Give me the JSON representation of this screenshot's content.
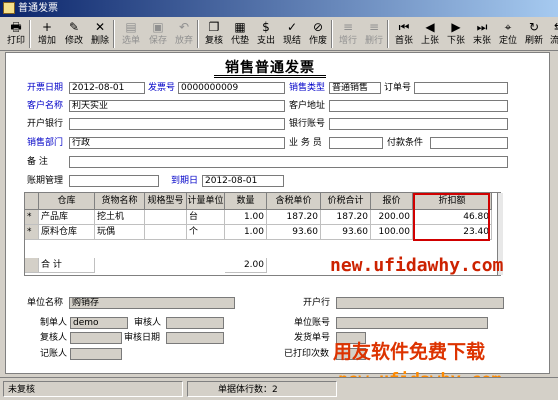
{
  "window": {
    "title": "普通发票"
  },
  "toolbar": [
    {
      "icon": "🖶",
      "label": "打印",
      "name": "print",
      "enabled": true
    },
    {
      "icon": "+",
      "label": "增加",
      "name": "add",
      "enabled": true
    },
    {
      "icon": "✎",
      "label": "修改",
      "name": "modify",
      "enabled": true
    },
    {
      "icon": "✕",
      "label": "删除",
      "name": "delete",
      "enabled": true
    },
    {
      "icon": "▤",
      "label": "选单",
      "name": "select-order",
      "enabled": false
    },
    {
      "icon": "▣",
      "label": "保存",
      "name": "save",
      "enabled": false
    },
    {
      "icon": "↶",
      "label": "放弃",
      "name": "abandon",
      "enabled": false
    },
    {
      "icon": "❐",
      "label": "复核",
      "name": "review",
      "enabled": true
    },
    {
      "icon": "▦",
      "label": "代垫",
      "name": "advance",
      "enabled": true
    },
    {
      "icon": "$",
      "label": "支出",
      "name": "expense",
      "enabled": true
    },
    {
      "icon": "✓",
      "label": "现结",
      "name": "cash-settle",
      "enabled": true
    },
    {
      "icon": "⊘",
      "label": "作废",
      "name": "void",
      "enabled": true
    },
    {
      "icon": "≡",
      "label": "增行",
      "name": "add-row",
      "enabled": false
    },
    {
      "icon": "≡",
      "label": "删行",
      "name": "delete-row",
      "enabled": false
    },
    {
      "icon": "⏮",
      "label": "首张",
      "name": "first",
      "enabled": true
    },
    {
      "icon": "◀",
      "label": "上张",
      "name": "prev",
      "enabled": true
    },
    {
      "icon": "▶",
      "label": "下张",
      "name": "next",
      "enabled": true
    },
    {
      "icon": "⏭",
      "label": "末张",
      "name": "last",
      "enabled": true
    },
    {
      "icon": "⌖",
      "label": "定位",
      "name": "locate",
      "enabled": true
    },
    {
      "icon": "↻",
      "label": "刷新",
      "name": "refresh",
      "enabled": true
    },
    {
      "icon": "⇆",
      "label": "流转",
      "name": "flow",
      "enabled": true
    }
  ],
  "form": {
    "title": "销售普通发票",
    "fields": {
      "invoice_date_label": "开票日期",
      "invoice_date": "2012-08-01",
      "invoice_no_label": "发票号",
      "invoice_no": "0000000009",
      "sales_type_label": "销售类型",
      "sales_type": "普通销售",
      "order_no_label": "订单号",
      "order_no": "",
      "customer_label": "客户名称",
      "customer": "利天实业",
      "customer_addr_label": "客户地址",
      "customer_addr": "",
      "bank_label": "开户银行",
      "bank": "",
      "account_label": "银行账号",
      "account": "",
      "dept_label": "销售部门",
      "dept": "行政",
      "salesman_label": "业 务 员",
      "salesman": "",
      "terms_label": "付款条件",
      "terms": "",
      "remark_label": "备    注",
      "remark": "",
      "period_label": "账期管理",
      "period": "",
      "due_label": "到期日",
      "due": "2012-08-01"
    }
  },
  "grid": {
    "headers": [
      "仓库",
      "货物名称",
      "规格型号",
      "计量单位",
      "数量",
      "含税单价",
      "价税合计",
      "报价",
      "折扣额"
    ],
    "rows": [
      {
        "mark": "*",
        "warehouse": "产品库",
        "goods": "挖土机",
        "spec": "",
        "unit": "台",
        "qty": "1.00",
        "price": "187.20",
        "total": "187.20",
        "quote": "200.00",
        "discount": "46.80"
      },
      {
        "mark": "*",
        "warehouse": "原料仓库",
        "goods": "玩偶",
        "spec": "",
        "unit": "个",
        "qty": "1.00",
        "price": "93.60",
        "total": "93.60",
        "quote": "100.00",
        "discount": "23.40"
      }
    ],
    "total_label": "合  计",
    "total_qty": "2.00"
  },
  "footer": {
    "unit_name_label": "单位名称",
    "unit_name": "购销存",
    "issuing_bank_label": "开户行",
    "maker_label": "制单人",
    "maker": "demo",
    "reviewer_label": "审核人",
    "unit_account_label": "单位账号",
    "recheck_label": "复核人",
    "review_date_label": "审核日期",
    "shipping_no_label": "发货单号",
    "bookkeeper_label": "记账人",
    "print_count_label": "已打印次数"
  },
  "status": {
    "left": "未复核",
    "middle": "单据体行数：2"
  },
  "watermarks": {
    "url": "new.ufidawhy.com",
    "brand": "用友软件免费下载",
    "url2": "new.ufidawhy.com"
  },
  "colors": {
    "label_blue": "#0000c8",
    "highlight_red": "#d00000",
    "titlebar": "#0a246a"
  }
}
